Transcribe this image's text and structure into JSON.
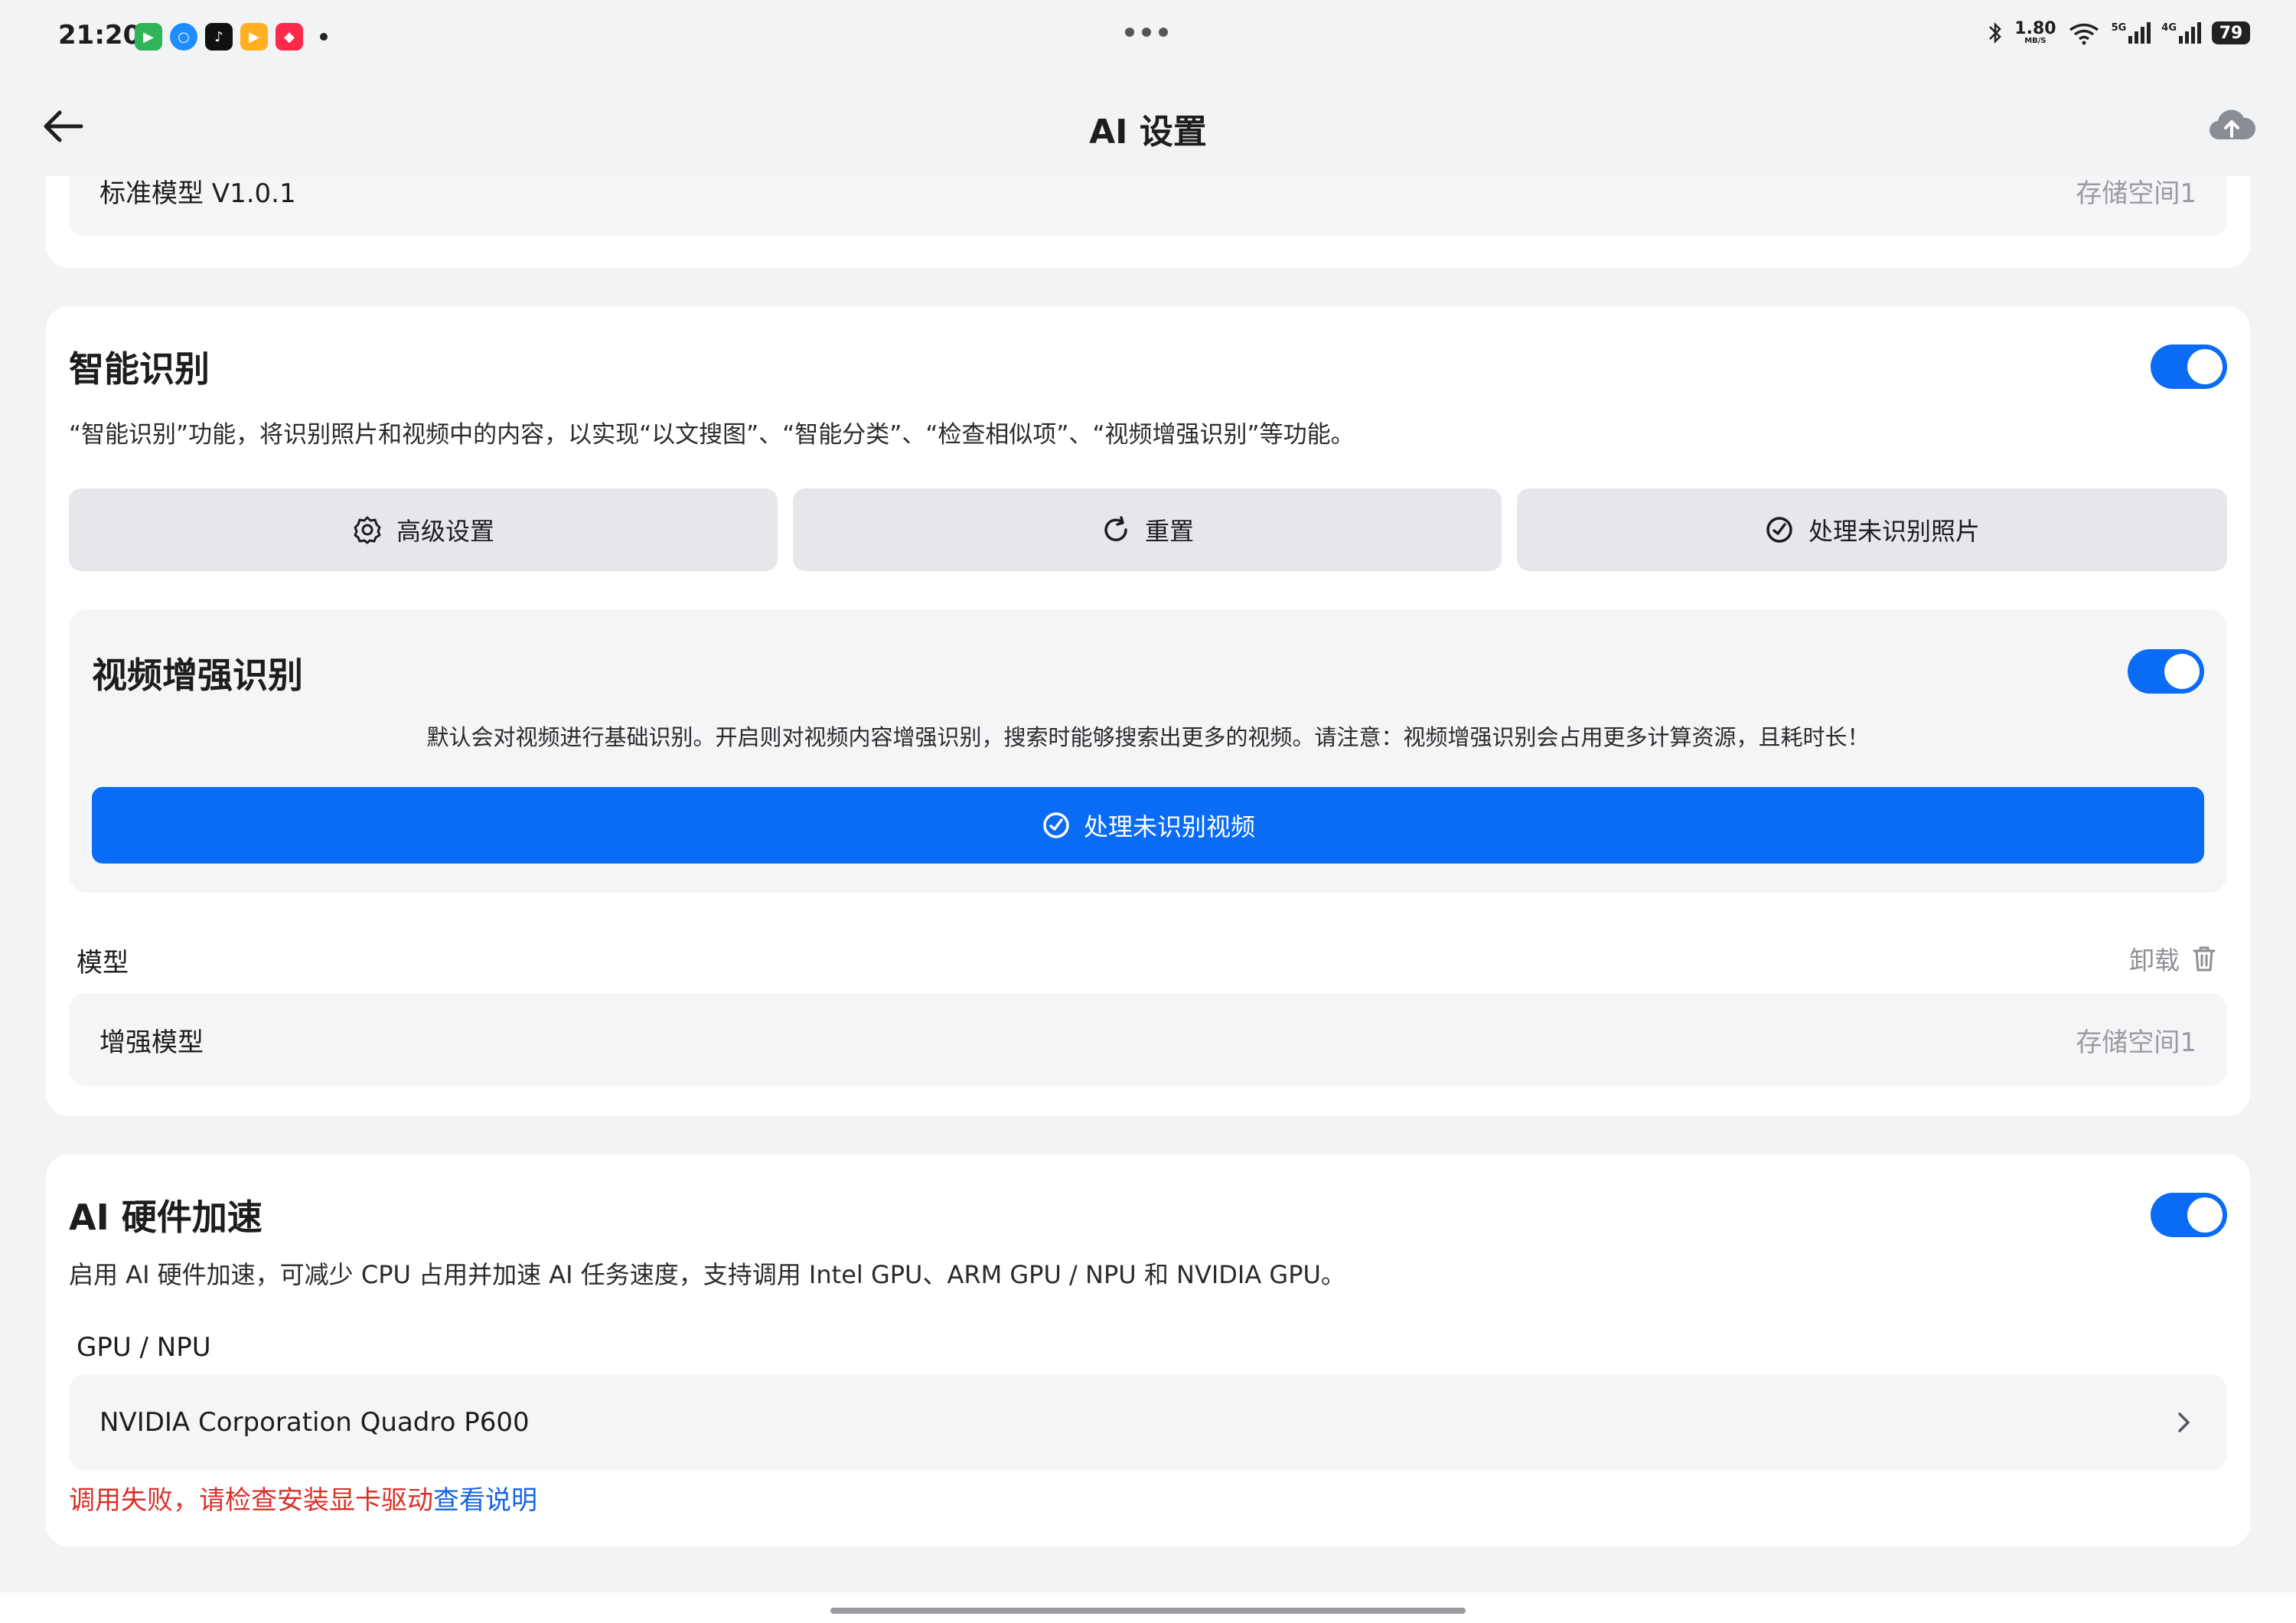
{
  "status_bar": {
    "time": "21:20",
    "net_speed": "1.80",
    "net_unit": "MB/S",
    "battery": "79",
    "signal_labels": [
      "5G",
      "4G"
    ]
  },
  "header": {
    "title": "AI 设置"
  },
  "standard_model": {
    "name": "标准模型 V1.0.1",
    "storage": "存储空间1"
  },
  "smart_recognition": {
    "title": "智能识别",
    "description": "“智能识别”功能，将识别照片和视频中的内容，以实现“以文搜图”、“智能分类”、“检查相似项”、“视频增强识别”等功能。",
    "buttons": {
      "advanced": "高级设置",
      "reset": "重置",
      "process_photos": "处理未识别照片"
    },
    "video": {
      "title": "视频增强识别",
      "description": "默认会对视频进行基础识别。开启则对视频内容增强识别，搜索时能够搜索出更多的视频。请注意：视频增强识别会占用更多计算资源，且耗时长！",
      "process_button": "处理未识别视频"
    },
    "model_label": "模型",
    "uninstall_label": "卸载",
    "enhanced_model": {
      "name": "增强模型",
      "storage": "存储空间1"
    }
  },
  "hardware_accel": {
    "title": "AI 硬件加速",
    "description": "启用 AI 硬件加速，可减少 CPU 占用并加速 AI 任务速度，支持调用 Intel GPU、ARM GPU / NPU 和 NVIDIA GPU。",
    "gpu_label": "GPU / NPU",
    "gpu_value": "NVIDIA Corporation Quadro P600",
    "error_text": "调用失败，请检查安装显卡驱动",
    "error_link": "查看说明"
  },
  "colors": {
    "accent": "#0a6cf5",
    "error": "#d8312a",
    "link": "#1565e0",
    "background": "#f2f3f5"
  },
  "icons": {
    "back": "arrow-left-icon",
    "upload": "cloud-upload-icon",
    "advanced": "gear-icon",
    "reset": "refresh-icon",
    "process": "gauge-check-icon",
    "uninstall": "trash-icon",
    "gpu_chevron": "chevron-right-icon"
  }
}
